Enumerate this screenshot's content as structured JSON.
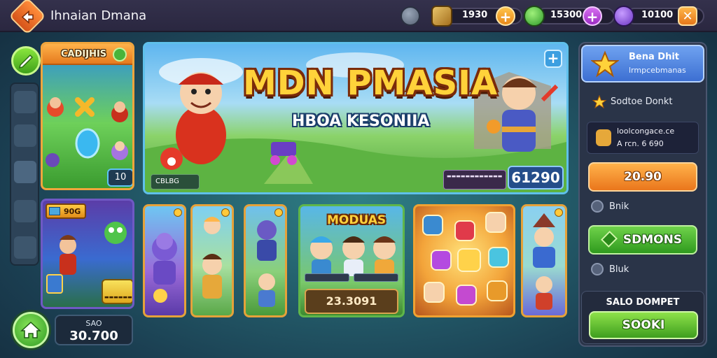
{
  "app": {
    "title": "Ihnaian Dmana"
  },
  "topbar": {
    "currencies": [
      {
        "icon": "treasure-map-icon",
        "value": "1930"
      },
      {
        "icon": "green-gem-icon",
        "value": "15300"
      },
      {
        "icon": "purple-potion-icon",
        "value": "10100"
      }
    ]
  },
  "left": {
    "cards_panel": {
      "title": "CADIJHIS",
      "count": "10"
    },
    "deck_panel": {
      "tag": "90G"
    },
    "score": {
      "label": "SAO",
      "value": "30.700"
    }
  },
  "hero": {
    "title": "MDN PMASIA",
    "subtitle": "HBOA KESONIIA",
    "chip_left": "CBLBG",
    "price": "61290"
  },
  "modes": {
    "title": "MODUAS",
    "value": "23.3091"
  },
  "right": {
    "header_title": "Bena Dhit",
    "header_subtitle": "lrmpcebmanas",
    "row_title": "Sodtoe Donkt",
    "info_lines": [
      "loolcongace.ce",
      "A rcn. 6 690"
    ],
    "orange_button": "20.90",
    "row_link_1": "Bnik",
    "green_button": "SDMONS",
    "row_link_2": "Bluk",
    "footer_label": "SALO DOMPET",
    "footer_button": "SOOKI"
  },
  "colors": {
    "accent_orange": "#f39b2a",
    "accent_green": "#4fb62c",
    "panel_dark": "#2a3448",
    "hero_border": "#5fc0ea"
  }
}
